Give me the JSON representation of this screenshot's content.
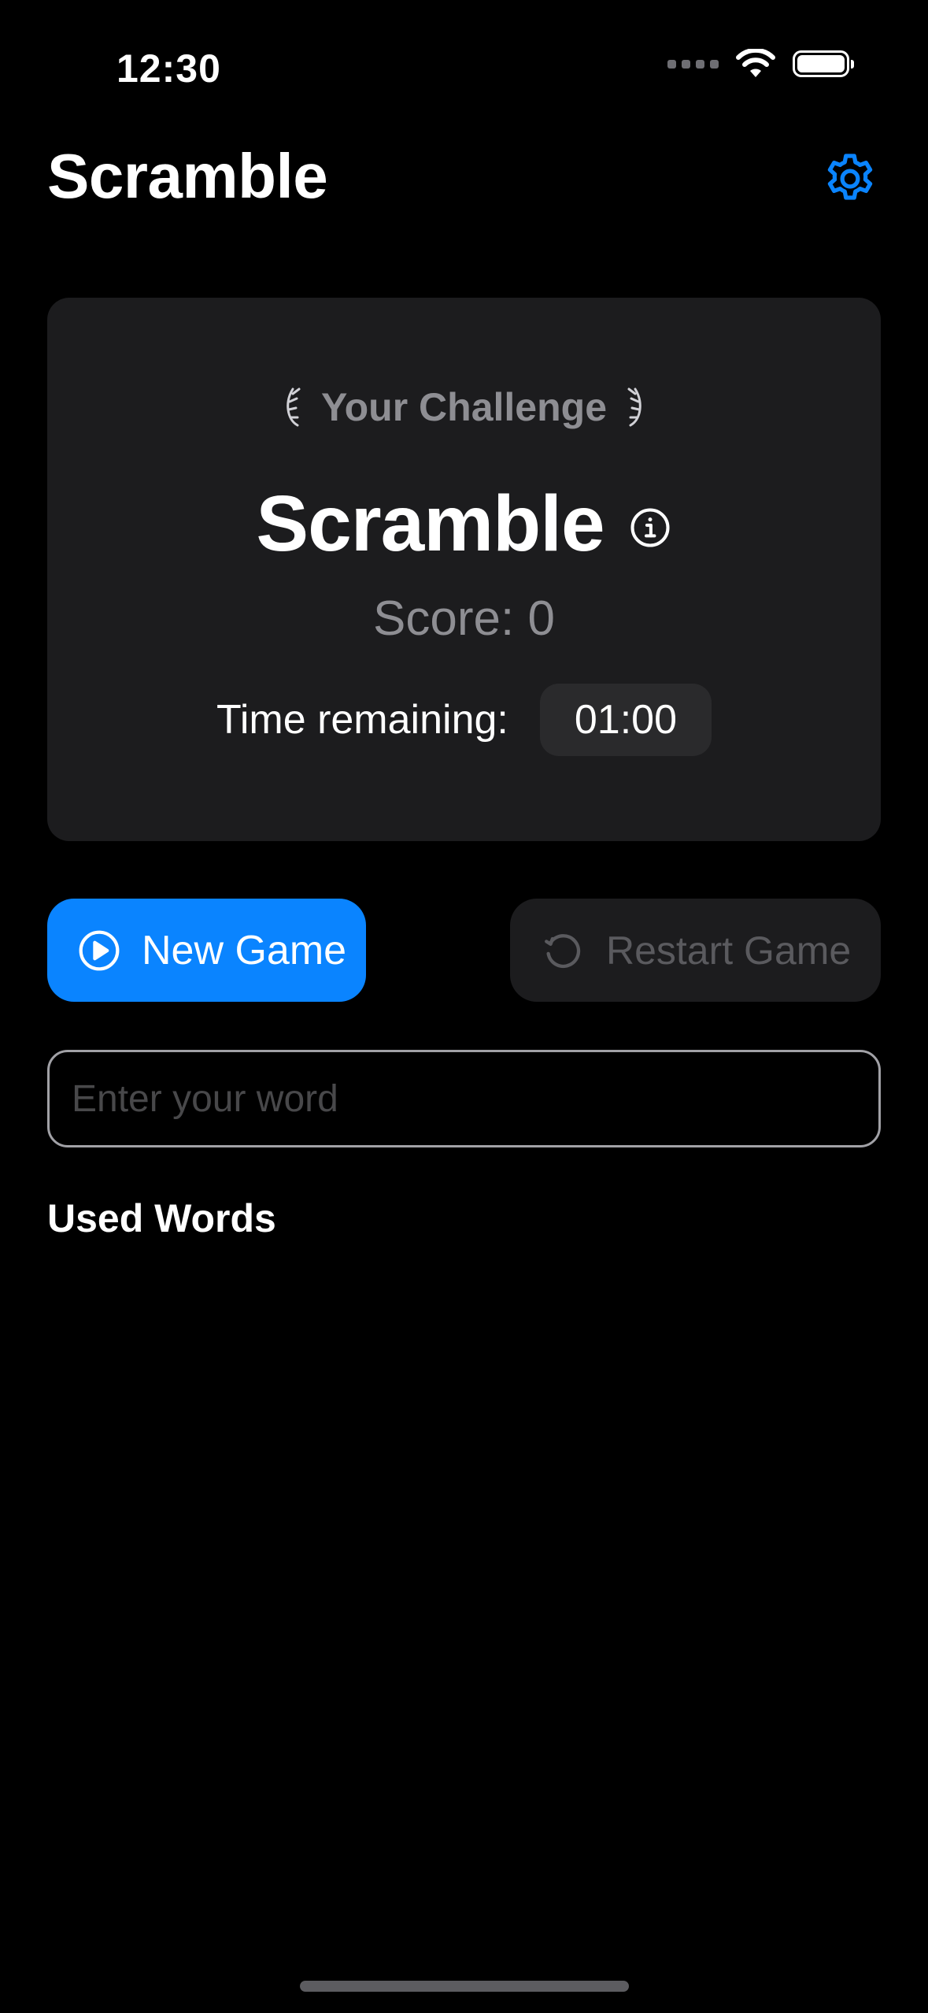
{
  "status_bar": {
    "time": "12:30"
  },
  "header": {
    "title": "Scramble",
    "settings_icon": "gear-icon"
  },
  "challenge": {
    "label": "Your Challenge",
    "word": "Scramble",
    "score_text": "Score: 0",
    "time_label": "Time remaining:",
    "time_value": "01:00"
  },
  "actions": {
    "new_game_label": "New Game",
    "restart_label": "Restart Game",
    "restart_enabled": false
  },
  "input": {
    "placeholder": "Enter your word",
    "value": ""
  },
  "used_words": {
    "heading": "Used Words",
    "items": []
  },
  "colors": {
    "accent": "#0a84ff",
    "background": "#000000",
    "card": "#1c1c1e",
    "secondary_text": "#8e8e93",
    "disabled_text": "#5a5a5e"
  }
}
